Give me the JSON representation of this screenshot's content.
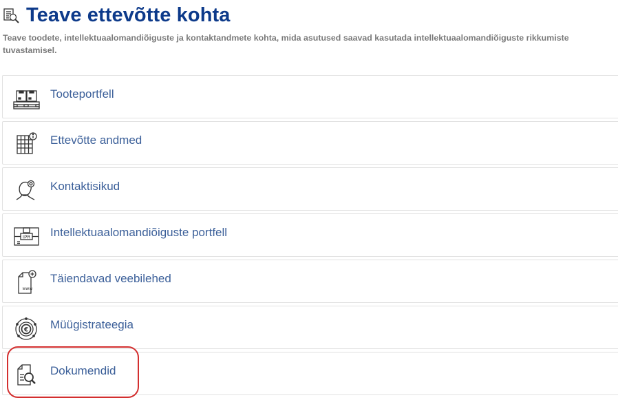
{
  "page": {
    "title": "Teave ettevõtte kohta",
    "subtitle": "Teave toodete, intellektuaalomandiõiguste ja kontaktandmete kohta, mida asutused saavad kasutada intellektuaalomandiõiguste rikkumiste tuvastamisel.",
    "title_icon": "building-search-icon"
  },
  "items": [
    {
      "label": "Tooteportfell",
      "icon": "pallet-boxes-icon"
    },
    {
      "label": "Ettevõtte andmed",
      "icon": "building-info-icon"
    },
    {
      "label": "Kontaktisikud",
      "icon": "contact-person-icon"
    },
    {
      "label": "Intellektuaalomandiõiguste portfell",
      "icon": "ipr-package-icon"
    },
    {
      "label": "Täiendavad veebilehed",
      "icon": "www-document-add-icon"
    },
    {
      "label": "Müügistrateegia",
      "icon": "euro-strategy-icon"
    },
    {
      "label": "Dokumendid",
      "icon": "document-search-icon"
    }
  ],
  "highlight": {
    "target": "Dokumendid",
    "color": "#d32f2f"
  },
  "colors": {
    "title": "#0d3a8a",
    "link": "#3b5f99",
    "subtitle": "#7a7a7a"
  }
}
